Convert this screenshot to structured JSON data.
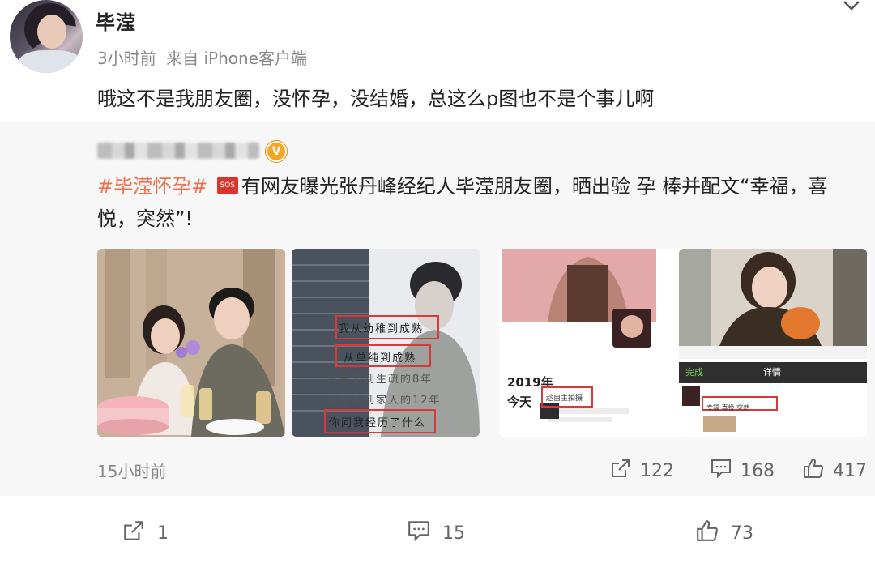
{
  "post": {
    "username": "毕滢",
    "time": "3小时前",
    "source": "来自 iPhone客户端",
    "text": "哦这不是我朋友圈，没怀孕，没结婚，总这么p图也不是个事儿啊"
  },
  "repost": {
    "hashtag": "#毕滢怀孕#",
    "badge_label": "SOS",
    "text_part1": "有网友曝光张丹峰经纪人毕滢朋友圈，晒出验 孕 棒并配文“幸福，喜悦，突然”!",
    "time": "15小时前",
    "share_count": "122",
    "comment_count": "168",
    "like_count": "417",
    "images": [
      {
        "kind": "photo-couple-birthday"
      },
      {
        "kind": "photo-poster-text",
        "lines": [
          "我从幼稚到成熟",
          "从单纯到成熟",
          "从真亲到生疏的8年",
          "从恋人到家人的12年",
          "你问我经历了什么"
        ]
      },
      {
        "kind": "screenshot-moments",
        "year": "2019年",
        "today": "今天",
        "badge": "趁自主拍摄"
      },
      {
        "kind": "screenshot-detail",
        "header_left": "完成",
        "header_title": "详情",
        "highlight": "幸福 喜悦 突然"
      }
    ]
  },
  "footer": {
    "share_count": "1",
    "comment_count": "15",
    "like_count": "73"
  },
  "colors": {
    "hashtag": "#eb7350",
    "verified": "#f5a623",
    "highlight_box": "#d83a3a"
  },
  "icons": [
    "share-icon",
    "comment-icon",
    "like-icon",
    "chevron-down-icon",
    "verified-icon"
  ]
}
